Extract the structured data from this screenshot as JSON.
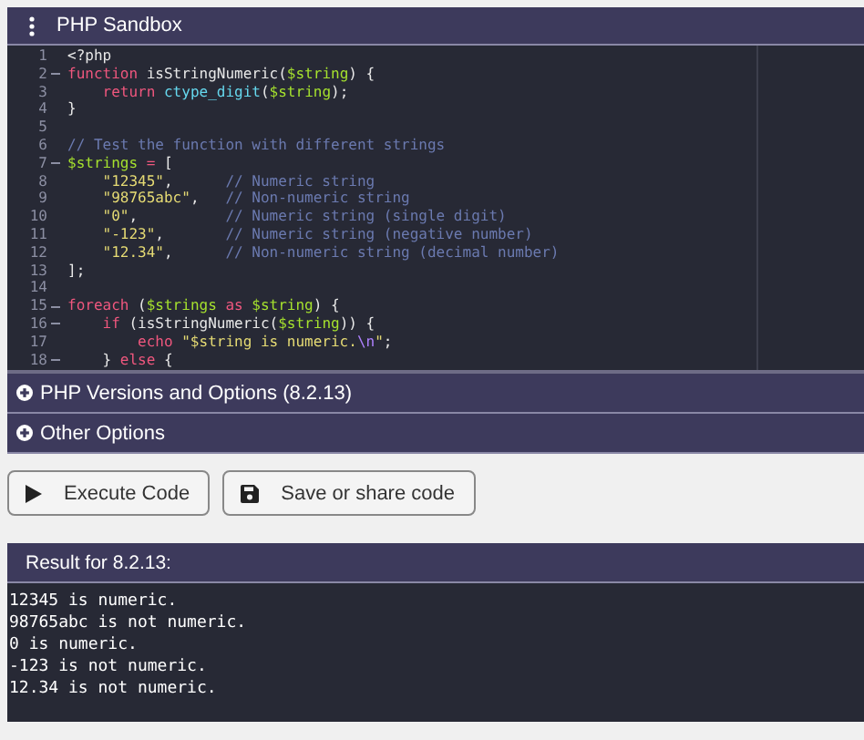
{
  "window": {
    "title": "PHP Sandbox"
  },
  "editor": {
    "lines": [
      {
        "number": "1",
        "fold": false,
        "tokens": [
          {
            "kind": "plain",
            "text": "<?php"
          }
        ]
      },
      {
        "number": "2",
        "fold": true,
        "tokens": [
          {
            "kind": "keyword",
            "text": "function"
          },
          {
            "kind": "plain",
            "text": " isStringNumeric("
          },
          {
            "kind": "variable",
            "text": "$string"
          },
          {
            "kind": "plain",
            "text": ") {"
          }
        ]
      },
      {
        "number": "3",
        "fold": false,
        "tokens": [
          {
            "kind": "keyword",
            "text": "    return"
          },
          {
            "kind": "builtin",
            "text": " ctype_digit"
          },
          {
            "kind": "plain",
            "text": "("
          },
          {
            "kind": "variable",
            "text": "$string"
          },
          {
            "kind": "plain",
            "text": ");"
          }
        ]
      },
      {
        "number": "4",
        "fold": false,
        "tokens": [
          {
            "kind": "plain",
            "text": "}"
          }
        ]
      },
      {
        "number": "5",
        "fold": false
      },
      {
        "number": "6",
        "fold": false,
        "tokens": [
          {
            "kind": "comment",
            "text": "// Test the function with different strings"
          }
        ]
      },
      {
        "number": "7",
        "fold": true,
        "tokens": [
          {
            "kind": "variable",
            "text": "$strings"
          },
          {
            "kind": "keyword",
            "text": " = "
          },
          {
            "kind": "plain",
            "text": "["
          }
        ]
      },
      {
        "number": "8",
        "fold": false,
        "tokens": [
          {
            "kind": "string",
            "text": "    \"12345\""
          },
          {
            "kind": "plain",
            "text": ",      "
          },
          {
            "kind": "comment",
            "text": "// Numeric string"
          }
        ]
      },
      {
        "number": "9",
        "fold": false,
        "tokens": [
          {
            "kind": "string",
            "text": "    \"98765abc\""
          },
          {
            "kind": "plain",
            "text": ",   "
          },
          {
            "kind": "comment",
            "text": "// Non-numeric string"
          }
        ]
      },
      {
        "number": "10",
        "fold": false,
        "tokens": [
          {
            "kind": "string",
            "text": "    \"0\""
          },
          {
            "kind": "plain",
            "text": ",          "
          },
          {
            "kind": "comment",
            "text": "// Numeric string (single digit)"
          }
        ]
      },
      {
        "number": "11",
        "fold": false,
        "tokens": [
          {
            "kind": "string",
            "text": "    \"-123\""
          },
          {
            "kind": "plain",
            "text": ",       "
          },
          {
            "kind": "comment",
            "text": "// Numeric string (negative number)"
          }
        ]
      },
      {
        "number": "12",
        "fold": false,
        "tokens": [
          {
            "kind": "string",
            "text": "    \"12.34\""
          },
          {
            "kind": "plain",
            "text": ",      "
          },
          {
            "kind": "comment",
            "text": "// Non-numeric string (decimal number)"
          }
        ]
      },
      {
        "number": "13",
        "fold": false,
        "tokens": [
          {
            "kind": "plain",
            "text": "];"
          }
        ]
      },
      {
        "number": "14",
        "fold": false
      },
      {
        "number": "15",
        "fold": true,
        "tokens": [
          {
            "kind": "keyword",
            "text": "foreach"
          },
          {
            "kind": "plain",
            "text": " ("
          },
          {
            "kind": "variable",
            "text": "$strings"
          },
          {
            "kind": "keyword",
            "text": " as "
          },
          {
            "kind": "variable",
            "text": "$string"
          },
          {
            "kind": "plain",
            "text": ") {"
          }
        ]
      },
      {
        "number": "16",
        "fold": true,
        "tokens": [
          {
            "kind": "keyword",
            "text": "    if"
          },
          {
            "kind": "plain",
            "text": " (isStringNumeric("
          },
          {
            "kind": "variable",
            "text": "$string"
          },
          {
            "kind": "plain",
            "text": ")) {"
          }
        ]
      },
      {
        "number": "17",
        "fold": false,
        "tokens": [
          {
            "kind": "keyword",
            "text": "        echo"
          },
          {
            "kind": "string",
            "text": " \"$string is numeric."
          },
          {
            "kind": "escape",
            "text": "\\n"
          },
          {
            "kind": "string",
            "text": "\""
          },
          {
            "kind": "plain",
            "text": ";"
          }
        ]
      },
      {
        "number": "18",
        "fold": true,
        "tokens": [
          {
            "kind": "plain",
            "text": "    } "
          },
          {
            "kind": "keyword",
            "text": "else"
          },
          {
            "kind": "plain",
            "text": " {"
          }
        ]
      }
    ]
  },
  "sections": [
    {
      "label": "PHP Versions and Options (8.2.13)",
      "expanded": false
    },
    {
      "label": "Other Options",
      "expanded": false
    }
  ],
  "buttons": [
    {
      "kind": "execute",
      "label": "Execute Code"
    },
    {
      "kind": "save",
      "label": "Save or share code"
    }
  ],
  "result": {
    "title": "Result for 8.2.13:",
    "output": [
      "12345 is numeric.",
      "98765abc is not numeric.",
      "0 is numeric.",
      "-123 is not numeric.",
      "12.34 is not numeric."
    ]
  }
}
